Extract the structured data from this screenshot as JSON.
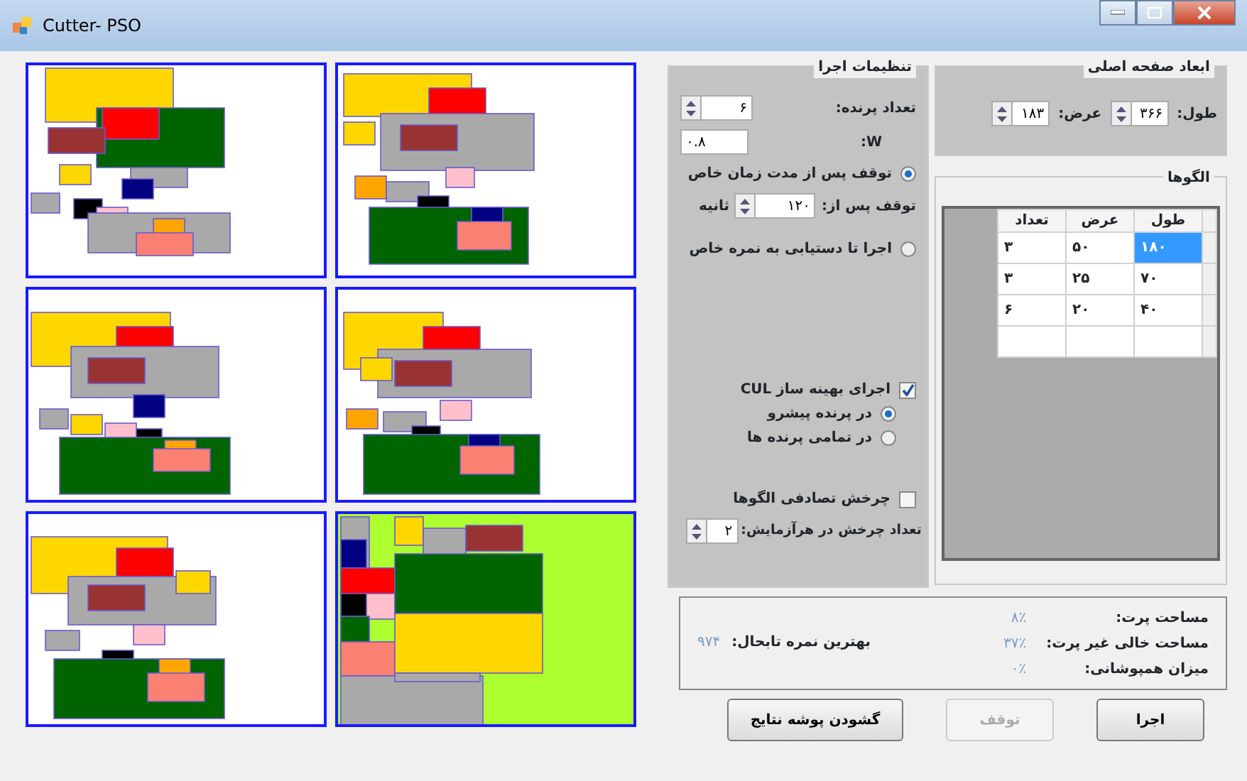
{
  "window": {
    "title": "Cutter- PSO"
  },
  "layout_panels": [
    {
      "kind": "packing"
    },
    {
      "kind": "packing"
    },
    {
      "kind": "packing"
    },
    {
      "kind": "packing"
    },
    {
      "kind": "packing"
    },
    {
      "kind": "filled"
    }
  ],
  "run_settings": {
    "title": "تنظیمات اجرا",
    "bird_count": {
      "label": "تعداد پرنده:",
      "value": "۶"
    },
    "w": {
      "label": "W:",
      "value": "۰.۸"
    },
    "stop_options": [
      {
        "label": "توقف پس از مدت زمان خاص",
        "selected": true
      },
      {
        "label": "اجرا تا دستیابی به نمره خاص",
        "selected": false
      }
    ],
    "stop_after": {
      "label": "توقف پس از:",
      "value": "۱۲۰",
      "unit": "ثانیه"
    },
    "cul": {
      "label": "اجرای بهینه ساز CUL",
      "checked": true
    },
    "cul_options": [
      {
        "label": "در پرنده پیشرو",
        "selected": true
      },
      {
        "label": "در تمامی پرنده ها",
        "selected": false
      }
    ],
    "random_rotation": {
      "label": "چرخش تصادفی الگوها",
      "checked": false
    },
    "rotation_count": {
      "label": "تعداد چرخش در هرآزمایش:",
      "value": "۲"
    }
  },
  "main_sheet": {
    "title": "ابعاد صفحه اصلی",
    "length": {
      "label": "طول:",
      "value": "۳۶۶"
    },
    "width": {
      "label": "عرض:",
      "value": "۱۸۳"
    }
  },
  "patterns": {
    "title": "الگوها",
    "columns": [
      "طول",
      "عرض",
      "تعداد"
    ],
    "rows": [
      {
        "cells": [
          "۱۸۰",
          "۵۰",
          "۳"
        ],
        "selected": true
      },
      {
        "cells": [
          "۷۰",
          "۲۵",
          "۳"
        ],
        "selected": false
      },
      {
        "cells": [
          "۴۰",
          "۲۰",
          "۶"
        ],
        "selected": false
      }
    ]
  },
  "results": {
    "stats": [
      {
        "label": "مساحت پرت:",
        "value": "۸٪"
      },
      {
        "label": "مساحت خالی غیر پرت:",
        "value": "۳۷٪"
      },
      {
        "label": "میزان همپوشانی:",
        "value": "۰٪"
      }
    ],
    "best": {
      "label": "بهترین نمره تابحال:",
      "value": "۹۷۴"
    }
  },
  "buttons": [
    {
      "label": "اجرا",
      "disabled": false
    },
    {
      "label": "توقف",
      "disabled": true
    },
    {
      "label": "گشودن پوشه نتایج",
      "disabled": false
    }
  ]
}
